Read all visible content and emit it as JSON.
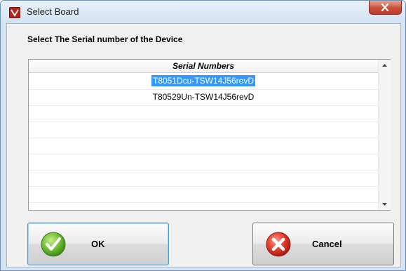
{
  "window": {
    "title": "Select Board"
  },
  "dialog": {
    "prompt": "Select The Serial number of the Device",
    "grid": {
      "column_header": "Serial Numbers",
      "rows": [
        "T8051Dcu-TSW14J56revD",
        "T80529Un-TSW14J56revD",
        "",
        "",
        "",
        "",
        "",
        "",
        ""
      ],
      "selected_index": 0
    },
    "buttons": {
      "ok_label": "OK",
      "cancel_label": "Cancel"
    }
  },
  "icons": {
    "app": "app-logo-icon",
    "close": "close-icon",
    "ok": "green-check-icon",
    "cancel": "red-x-icon",
    "scroll_up": "chevron-up-icon",
    "scroll_down": "chevron-down-icon"
  },
  "colors": {
    "selection": "#3399ff",
    "ok_icon": "#5aa82a",
    "cancel_icon": "#d1281c",
    "close_button": "#c8503a"
  }
}
